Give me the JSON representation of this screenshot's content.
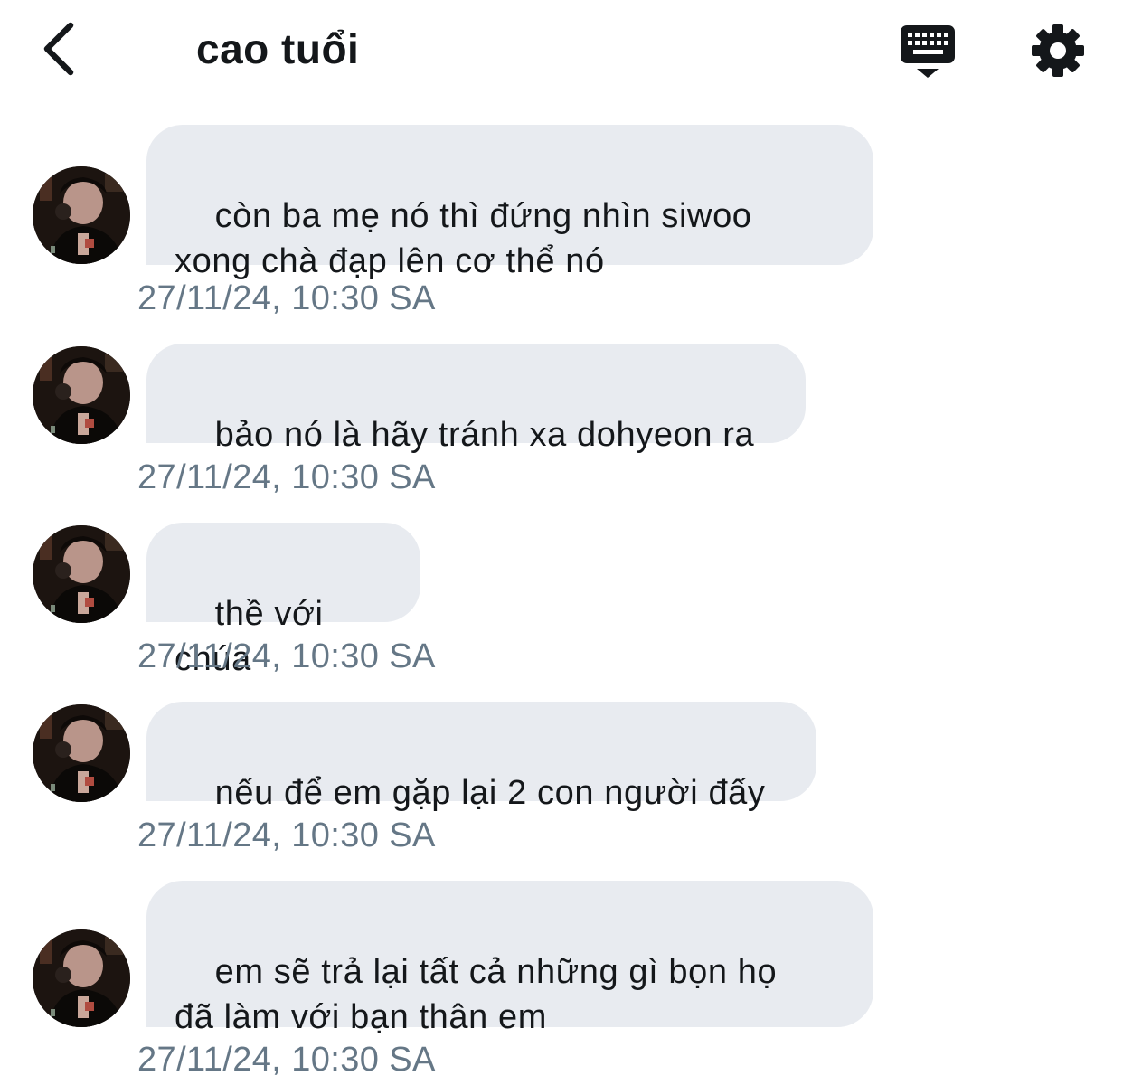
{
  "header": {
    "back_icon": "chevron-left-icon",
    "title": "cao tuổi",
    "keyboard_icon": "keyboard-icon",
    "settings_icon": "gear-icon"
  },
  "messages": [
    {
      "text": "còn ba mẹ nó thì đứng nhìn siwoo\nxong chà đạp lên cơ thể nó",
      "time": "27/11/24, 10:30 SA"
    },
    {
      "text": "bảo nó là hãy tránh xa dohyeon ra",
      "time": "27/11/24, 10:30 SA"
    },
    {
      "text": "thề với chúa",
      "time": "27/11/24, 10:30 SA"
    },
    {
      "text": "nếu để em gặp lại 2 con người đấy",
      "time": "27/11/24, 10:30 SA"
    },
    {
      "text": "em sẽ trả lại tất cả những gì bọn họ\nđã làm với bạn thân em",
      "time": "27/11/24, 10:30 SA"
    }
  ],
  "colors": {
    "bubble_bg": "#e8ebf0",
    "timestamp": "#657786",
    "text": "#14171a"
  }
}
